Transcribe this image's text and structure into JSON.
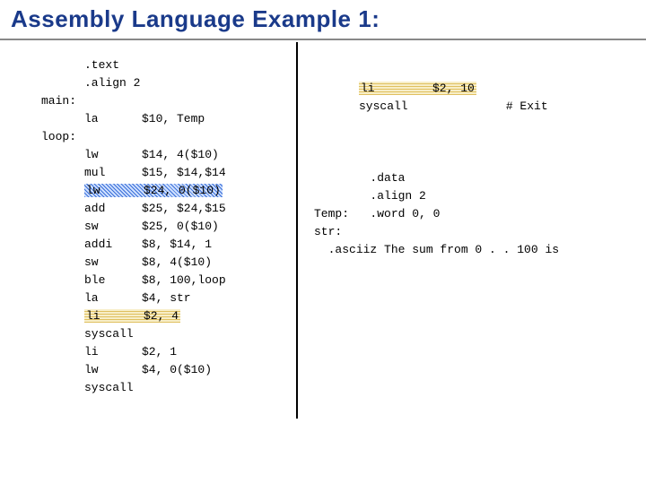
{
  "title": "Assembly Language Example 1:",
  "left": {
    "text": ".text",
    "align": ".align 2",
    "main_label": "main:",
    "la": "la",
    "la_args": "$10, Temp",
    "loop_label": "loop:",
    "lw1": "lw",
    "lw1_args": "$14, 4($10)",
    "mul": "mul",
    "mul_args": "$15, $14,$14",
    "lw2": "lw",
    "lw2_args": "$24, 0($10)",
    "add": "add",
    "add_args": "$25, $24,$15",
    "sw1": "sw",
    "sw1_args": "$25, 0($10)",
    "addi": "addi",
    "addi_args": "$8, $14, 1",
    "sw2": "sw",
    "sw2_args": "$8, 4($10)",
    "ble": "ble",
    "ble_args": "$8, 100,loop",
    "la2": "la",
    "la2_args": "$4, str",
    "li1": "li",
    "li1_args": "$2, 4",
    "sys1": "syscall",
    "li2": "li",
    "li2_args": "$2, 1",
    "lw3": "lw",
    "lw3_args": "$4, 0($10)",
    "sys2": "syscall"
  },
  "right1": {
    "li": "li",
    "li_args": "$2, 10",
    "syscall": "syscall",
    "comment": "# Exit"
  },
  "right2": {
    "data": ".data",
    "align": ".align 2",
    "temp_label": "Temp:",
    "temp_val": ".word 0, 0",
    "str_label": "str:",
    "asciiz": ".asciiz The sum from 0 . . 100 is"
  }
}
